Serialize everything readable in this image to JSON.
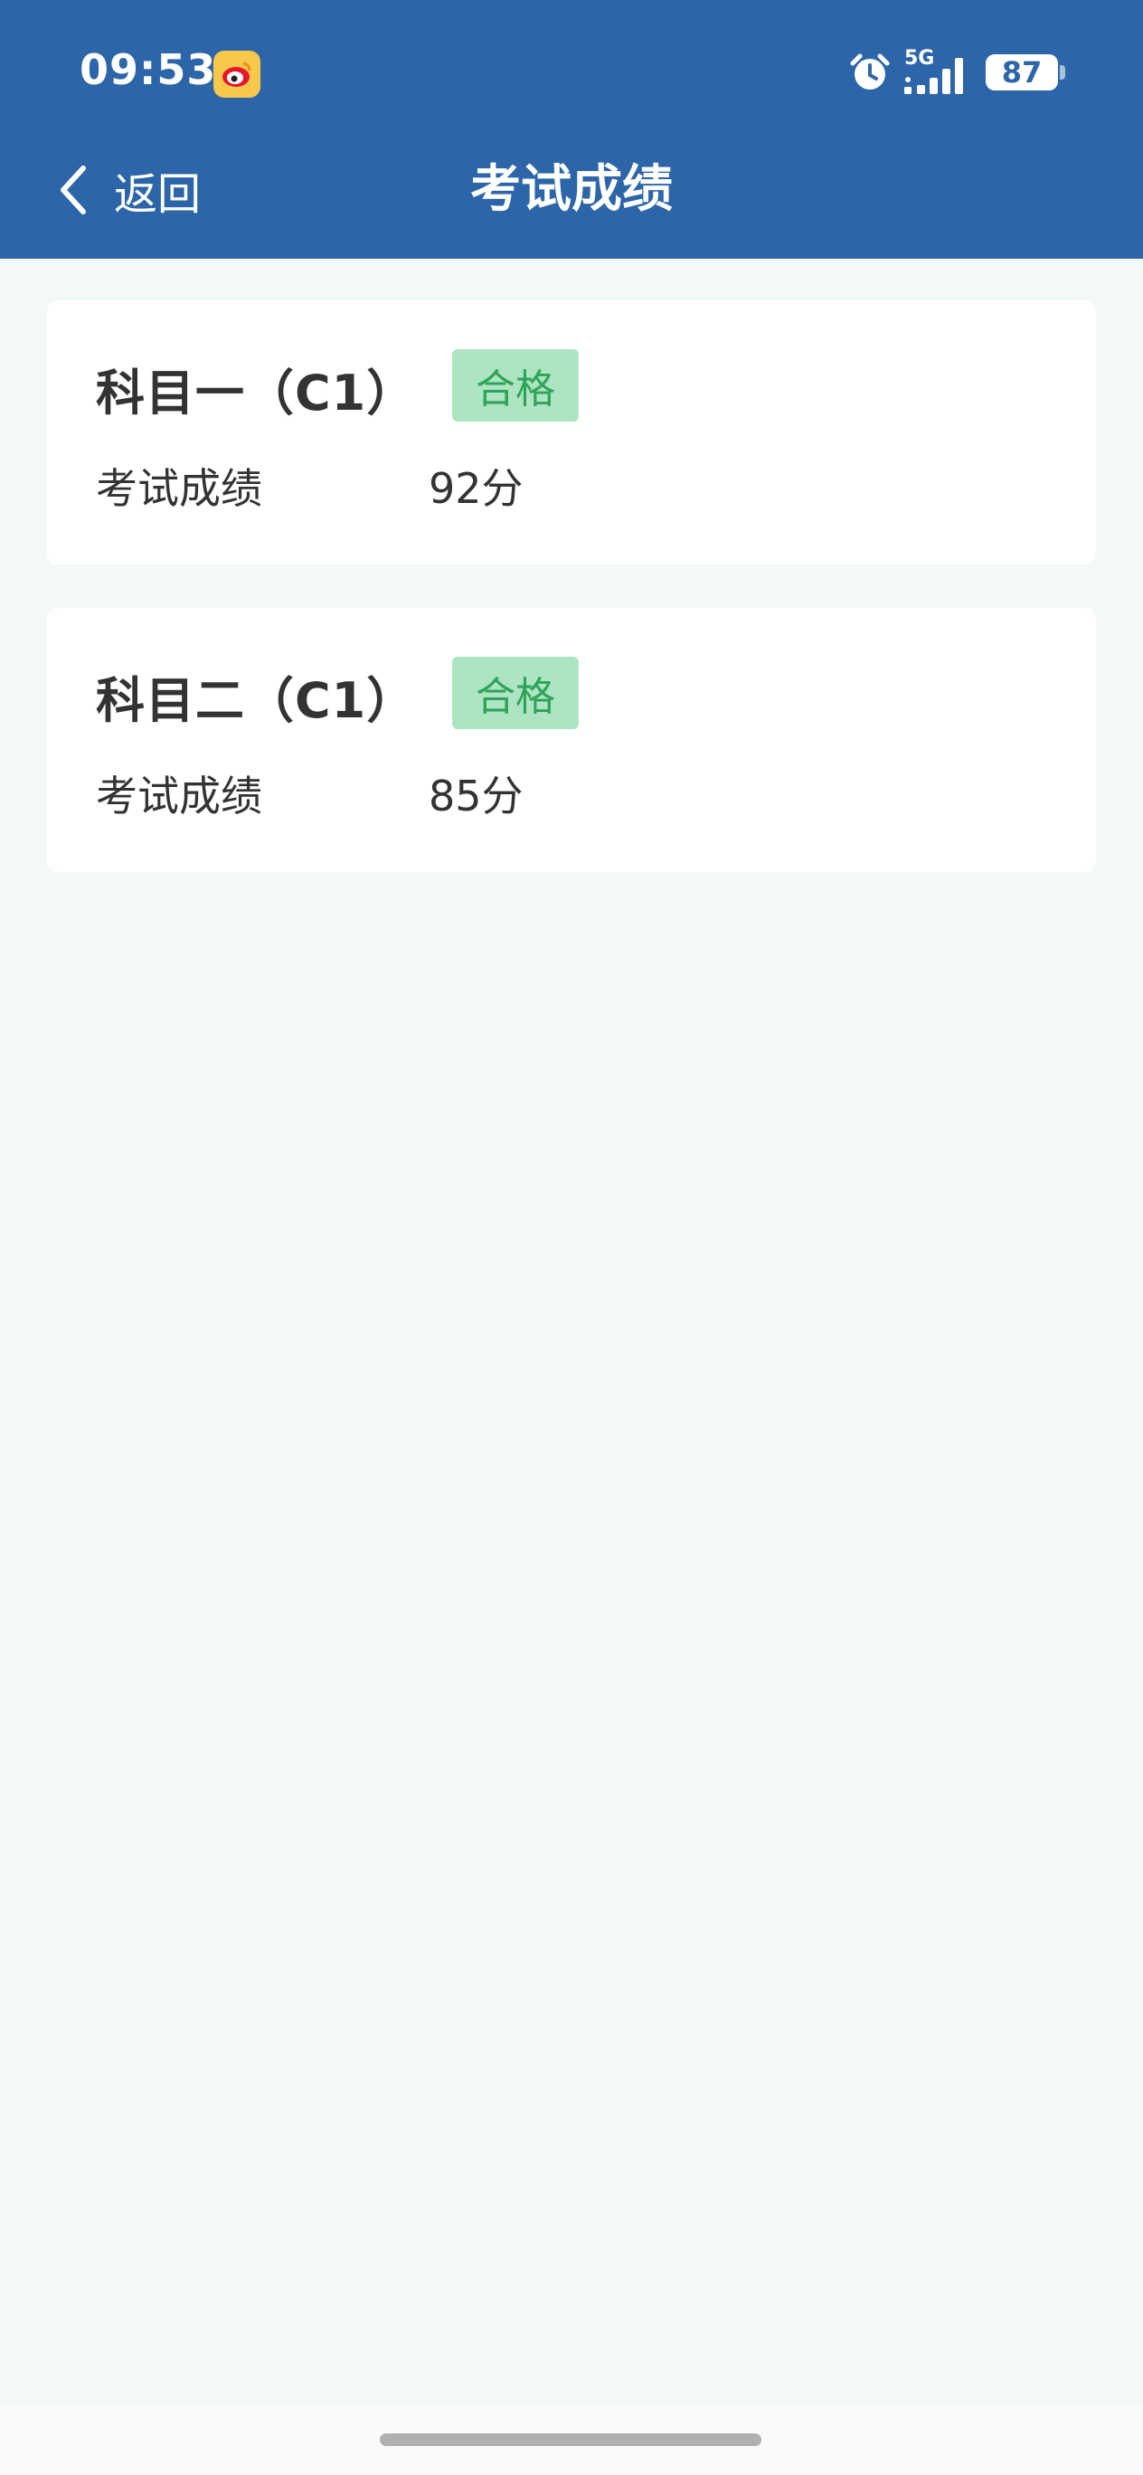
{
  "status_bar": {
    "time": "09:53",
    "network": "5G",
    "battery": "87"
  },
  "header": {
    "back_label": "返回",
    "title": "考试成绩"
  },
  "results": [
    {
      "subject": "科目一（C1）",
      "status": "合格",
      "score_label": "考试成绩",
      "score": "92分"
    },
    {
      "subject": "科目二（C1）",
      "status": "合格",
      "score_label": "考试成绩",
      "score": "85分"
    }
  ],
  "colors": {
    "header_bg": "#2c65a8",
    "page_bg": "#f3f8f9",
    "badge_bg": "#ade4c2",
    "badge_text": "#2fa35a"
  },
  "icons": [
    "weibo-icon",
    "alarm-icon",
    "signal-icon",
    "battery-icon",
    "back-chevron-icon"
  ]
}
